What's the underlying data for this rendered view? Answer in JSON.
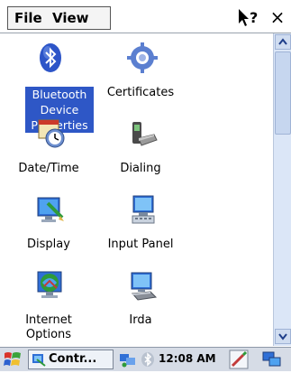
{
  "menu": {
    "file": "File",
    "view": "View",
    "close": "×"
  },
  "items": [
    {
      "label": "Bluetooth\nDevice\nProperties",
      "icon": "bluetooth-icon",
      "selected": true
    },
    {
      "label": "Certificates",
      "icon": "certificates-icon",
      "selected": false
    },
    {
      "label": "Date/Time",
      "icon": "date-time-icon",
      "selected": false
    },
    {
      "label": "Dialing",
      "icon": "dialing-icon",
      "selected": false
    },
    {
      "label": "Display",
      "icon": "display-icon",
      "selected": false
    },
    {
      "label": "Input Panel",
      "icon": "input-panel-icon",
      "selected": false
    },
    {
      "label": "Internet\nOptions",
      "icon": "internet-options-icon",
      "selected": false
    },
    {
      "label": "Irda",
      "icon": "irda-icon",
      "selected": false
    }
  ],
  "taskbar": {
    "task_label": "Contr...",
    "clock": "12:08 AM"
  },
  "colors": {
    "selection": "#2e57c6",
    "taskbar": "#d6dce6",
    "scrollbar": "#dbe6f7"
  }
}
